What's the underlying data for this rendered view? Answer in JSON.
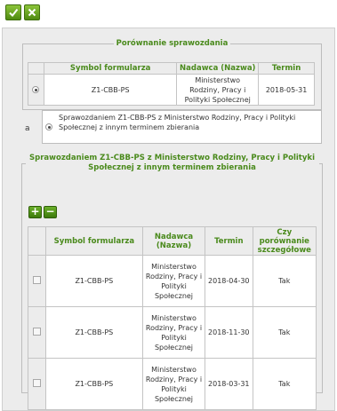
{
  "toolbar": {
    "accept_icon": "check-icon",
    "cancel_icon": "close-icon"
  },
  "comparison": {
    "legend": "Porównanie sprawozdania",
    "headers": [
      "Symbol formularza",
      "Nadawca (Nazwa)",
      "Termin"
    ],
    "rows": [
      {
        "symbol": "Z1-CBB-PS",
        "sender": "Ministerstwo Rodziny, Pracy i Polityki Społecznej",
        "term": "2018-05-31"
      }
    ]
  },
  "option": {
    "label": "a",
    "text": "Sprawozdaniem Z1-CBB-PS z Ministerstwo Rodziny, Pracy i Polityki Społecznej z innym terminem zbierania"
  },
  "other_terms": {
    "legend": "Sprawozdaniem Z1-CBB-PS z Ministerstwo Rodziny, Pracy i Polityki Społecznej z innym terminem zbierania",
    "add_label": "+",
    "remove_label": "−",
    "headers": [
      "Symbol formularza",
      "Nadawca (Nazwa)",
      "Termin",
      "Czy porównanie szczegółowe"
    ],
    "rows": [
      {
        "symbol": "Z1-CBB-PS",
        "sender": "Ministerstwo Rodziny, Pracy i Polityki Społecznej",
        "term": "2018-04-30",
        "detailed": "Tak"
      },
      {
        "symbol": "Z1-CBB-PS",
        "sender": "Ministerstwo Rodziny, Pracy i Polityki Społecznej",
        "term": "2018-11-30",
        "detailed": "Tak"
      },
      {
        "symbol": "Z1-CBB-PS",
        "sender": "Ministerstwo Rodziny, Pracy i Polityki Społecznej",
        "term": "2018-03-31",
        "detailed": "Tak"
      }
    ]
  }
}
